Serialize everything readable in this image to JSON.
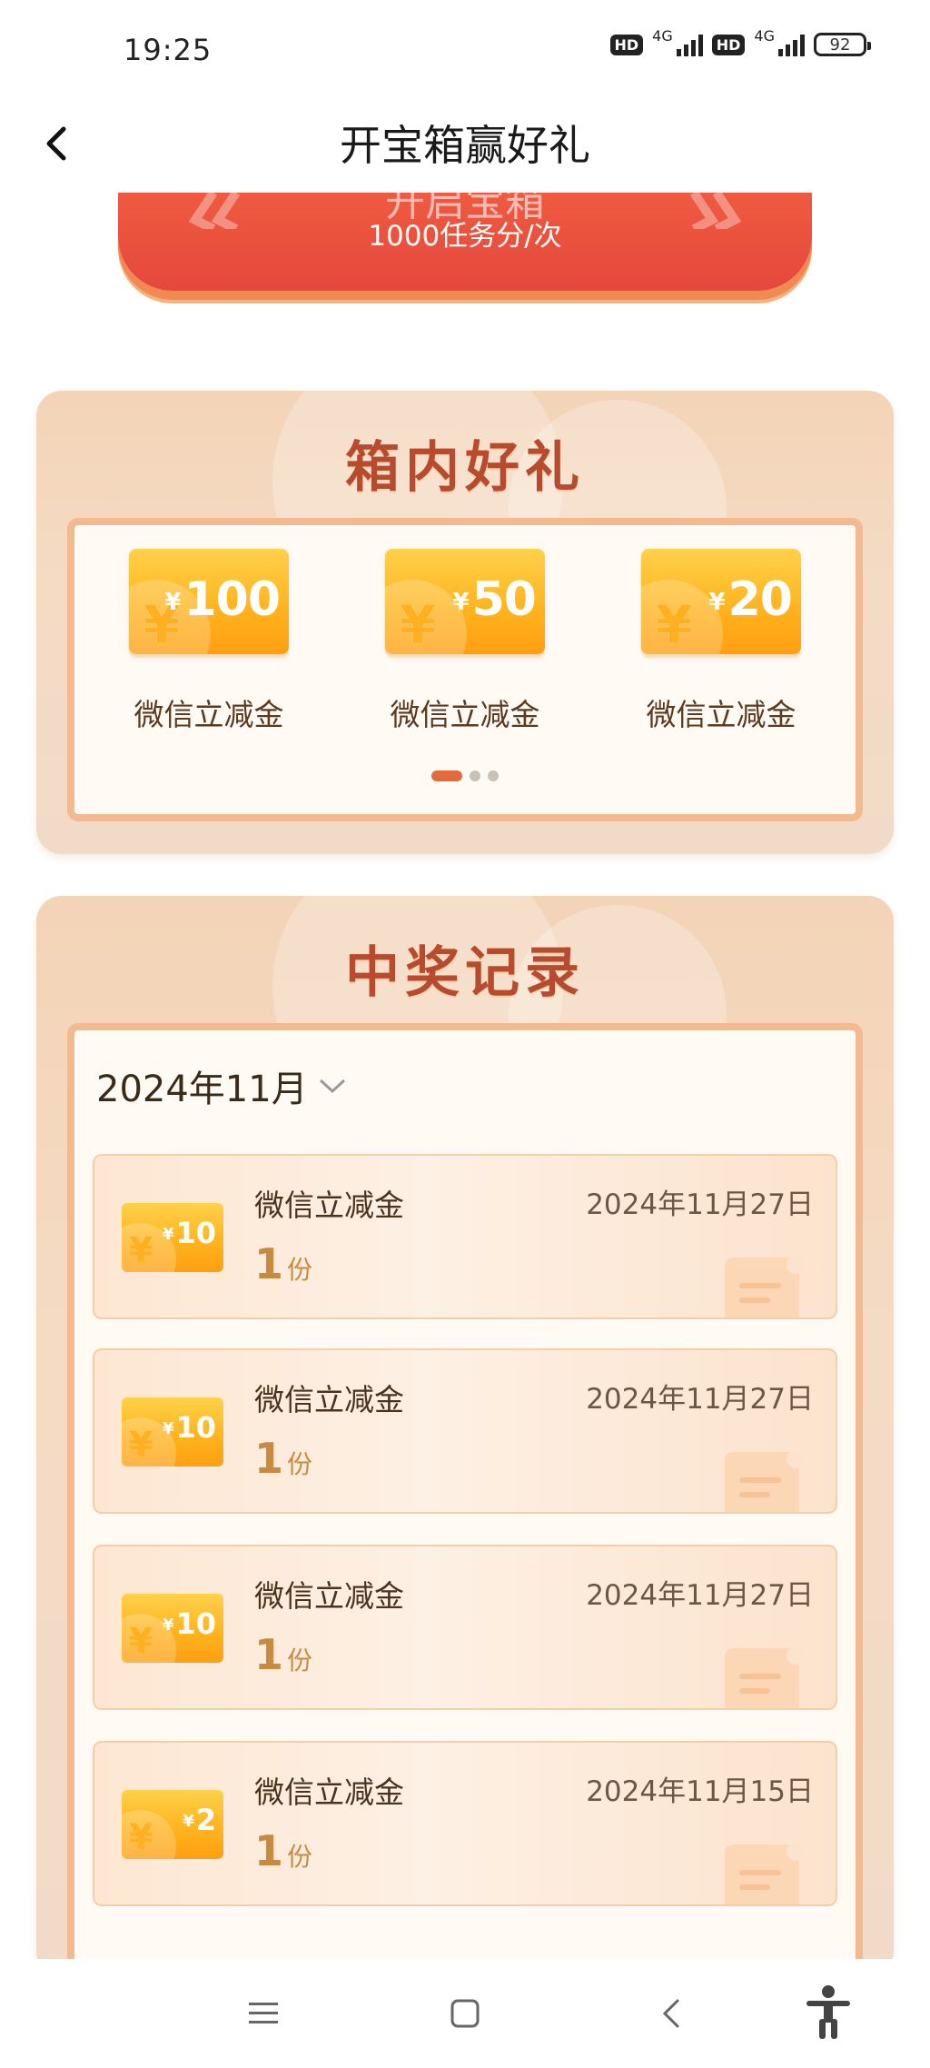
{
  "status_bar": {
    "time": "19:25",
    "hd1": "HD",
    "net1": "4G",
    "hd2": "HD",
    "net2": "4G",
    "battery": "92"
  },
  "header": {
    "title": "开宝箱赢好礼",
    "back_icon": "chevron-left-icon"
  },
  "banner": {
    "title_partial": "开启宝箱",
    "cost_text": "1000任务分/次"
  },
  "gifts_section": {
    "title": "箱内好礼",
    "items": [
      {
        "currency": "¥",
        "amount": "100",
        "label": "微信立减金"
      },
      {
        "currency": "¥",
        "amount": "50",
        "label": "微信立减金"
      },
      {
        "currency": "¥",
        "amount": "20",
        "label": "微信立减金"
      }
    ],
    "pager": {
      "total": 3,
      "active": 1
    }
  },
  "records_section": {
    "title": "中奖记录",
    "month_filter": "2024年11月",
    "records": [
      {
        "currency": "¥",
        "amount": "10",
        "name": "微信立减金",
        "qty": "1",
        "unit": "份",
        "date": "2024年11月27日"
      },
      {
        "currency": "¥",
        "amount": "10",
        "name": "微信立减金",
        "qty": "1",
        "unit": "份",
        "date": "2024年11月27日"
      },
      {
        "currency": "¥",
        "amount": "10",
        "name": "微信立减金",
        "qty": "1",
        "unit": "份",
        "date": "2024年11月27日"
      },
      {
        "currency": "¥",
        "amount": "2",
        "name": "微信立减金",
        "qty": "1",
        "unit": "份",
        "date": "2024年11月15日"
      }
    ]
  },
  "nav_bar": {
    "icons": [
      "menu-icon",
      "home-square-icon",
      "back-triangle-icon",
      "accessibility-icon"
    ]
  },
  "colors": {
    "accent": "#b84a2e",
    "banner": "#e5483c",
    "coupon": "#ffb21c",
    "panel": "#f3d4b7"
  }
}
